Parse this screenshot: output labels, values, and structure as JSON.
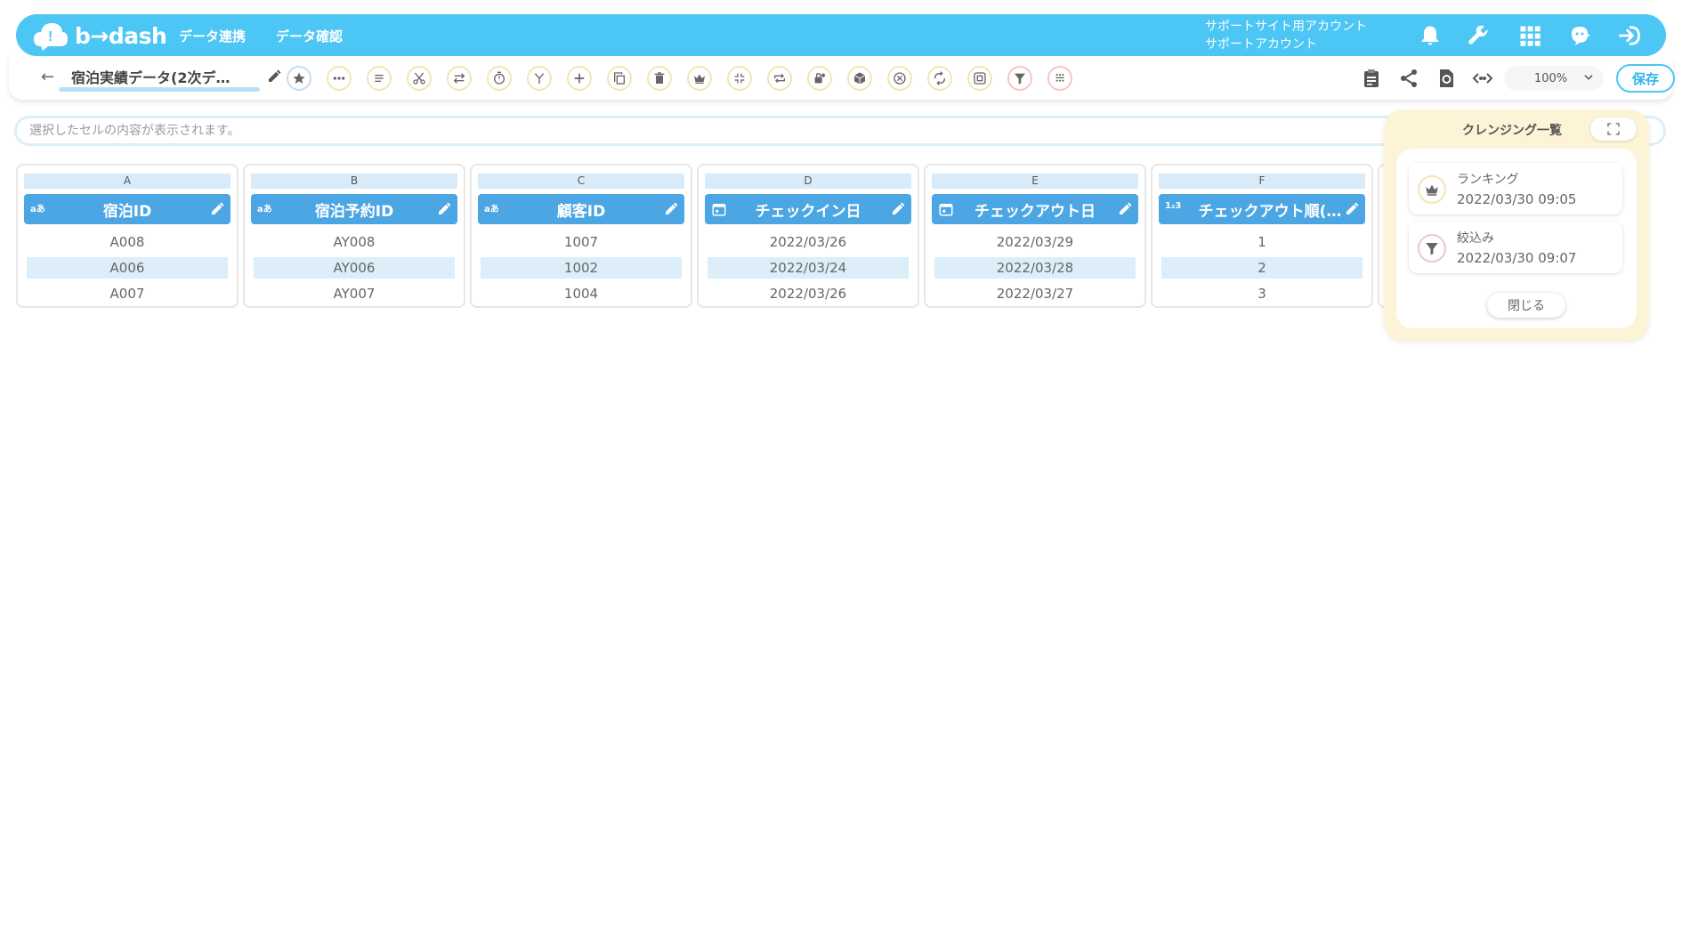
{
  "app": {
    "logo_text": "b→dash"
  },
  "nav": [
    {
      "label": "データ連携"
    },
    {
      "label": "データ確認"
    }
  ],
  "account": {
    "line1": "サポートサイト用アカウント",
    "line2": "サポートアカウント"
  },
  "header_icons": [
    "bell-icon",
    "wrench-icon",
    "apps-grid-icon",
    "chat-character-icon",
    "logout-icon"
  ],
  "toolbar": {
    "back_icon": "←",
    "data_title": "宿泊実績データ(2次デ…",
    "zoom": "100%",
    "save_label": "保存",
    "tool_icons": [
      "star",
      "more",
      "text-lines",
      "scissors",
      "transform",
      "timer",
      "merge",
      "add",
      "copy",
      "trash",
      "crown",
      "compress",
      "repeat",
      "lock-key",
      "package",
      "cancel",
      "replace",
      "target",
      "filter",
      "grid-dots"
    ],
    "right_icons": [
      "clipboard",
      "share",
      "refresh",
      "code"
    ]
  },
  "cell_content": {
    "placeholder": "選択したセルの内容が表示されます。"
  },
  "columns": [
    {
      "letter": "A",
      "type_icon": "aあ",
      "name": "宿泊ID",
      "cells": [
        "A008",
        "A006",
        "A007"
      ]
    },
    {
      "letter": "B",
      "type_icon": "aあ",
      "name": "宿泊予約ID",
      "cells": [
        "AY008",
        "AY006",
        "AY007"
      ]
    },
    {
      "letter": "C",
      "type_icon": "aあ",
      "name": "顧客ID",
      "cells": [
        "1007",
        "1002",
        "1004"
      ]
    },
    {
      "letter": "D",
      "type_icon": "calendar",
      "name": "チェックイン日",
      "cells": [
        "2022/03/26",
        "2022/03/24",
        "2022/03/26"
      ]
    },
    {
      "letter": "E",
      "type_icon": "calendar",
      "name": "チェックアウト日",
      "cells": [
        "2022/03/29",
        "2022/03/28",
        "2022/03/27"
      ]
    },
    {
      "letter": "F",
      "type_icon": "1₂3",
      "name": "チェックアウト順(…",
      "cells": [
        "1",
        "2",
        "3"
      ]
    }
  ],
  "cleansing_panel": {
    "title": "クレンジング一覧",
    "items": [
      {
        "icon": "crown-icon",
        "name": "ランキング",
        "date": "2022/03/30 09:05"
      },
      {
        "icon": "filter-icon",
        "name": "絞込み",
        "date": "2022/03/30 09:07"
      }
    ],
    "close_label": "閉じる"
  },
  "colors": {
    "brand": "#4cc6f5",
    "column_header": "#4ba6e3",
    "panel_bg": "#fdf3d6",
    "save_border": "#4cc6f5"
  }
}
